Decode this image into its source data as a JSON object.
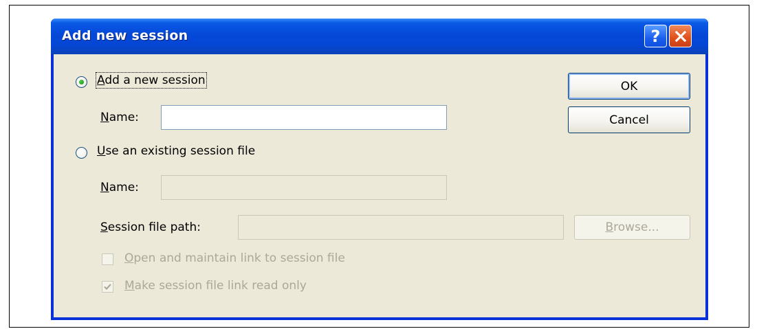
{
  "dialog": {
    "title": "Add new session",
    "help_glyph": "?",
    "colors": {
      "titlebar": "#0054e3",
      "client": "#ece9d8",
      "close": "#e0501a",
      "radio_dot": "#21a121"
    }
  },
  "new_session": {
    "radio_label_key": "A",
    "radio_label_rest": "dd a new session",
    "selected": true,
    "name_label_key": "N",
    "name_label_rest": "ame:",
    "name_value": ""
  },
  "existing_session": {
    "radio_label_key": "U",
    "radio_label_rest": "se an existing session file",
    "selected": false,
    "name_label_key": "N",
    "name_label_rest": "ame:",
    "name_value": "",
    "path_label_key": "S",
    "path_label_rest": "ession file path:",
    "path_value": "",
    "browse_label_key": "B",
    "browse_label_rest": "rowse...",
    "open_link_key": "O",
    "open_link_rest": "pen and maintain link to session file",
    "open_link_checked": false,
    "read_only_key": "M",
    "read_only_rest": "ake session file link read only",
    "read_only_checked": true
  },
  "buttons": {
    "ok": "OK",
    "cancel": "Cancel"
  }
}
